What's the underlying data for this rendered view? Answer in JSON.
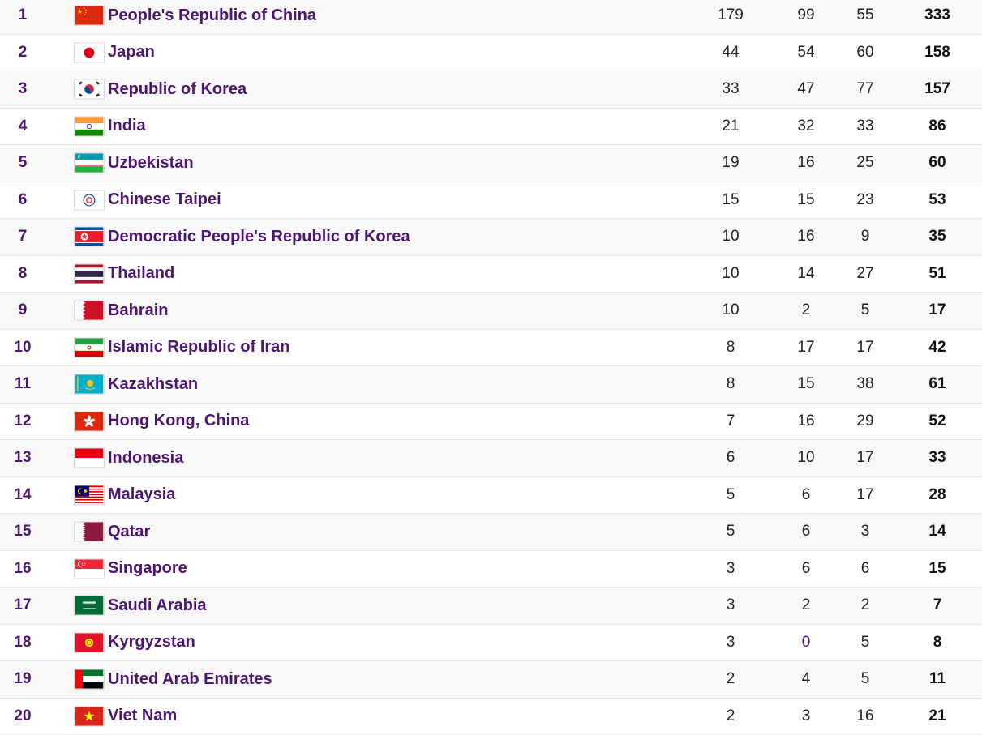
{
  "rows": [
    {
      "rank": "1",
      "country": "People's Republic of China",
      "flag": "china-flag",
      "gold": "179",
      "silver": "99",
      "bronze": "55",
      "total": "333"
    },
    {
      "rank": "2",
      "country": "Japan",
      "flag": "japan-flag",
      "gold": "44",
      "silver": "54",
      "bronze": "60",
      "total": "158"
    },
    {
      "rank": "3",
      "country": "Republic of Korea",
      "flag": "korea-flag",
      "gold": "33",
      "silver": "47",
      "bronze": "77",
      "total": "157"
    },
    {
      "rank": "4",
      "country": "India",
      "flag": "india-flag",
      "gold": "21",
      "silver": "32",
      "bronze": "33",
      "total": "86"
    },
    {
      "rank": "5",
      "country": "Uzbekistan",
      "flag": "uzbekistan-flag",
      "gold": "19",
      "silver": "16",
      "bronze": "25",
      "total": "60"
    },
    {
      "rank": "6",
      "country": "Chinese Taipei",
      "flag": "chinese-taipei-flag",
      "gold": "15",
      "silver": "15",
      "bronze": "23",
      "total": "53"
    },
    {
      "rank": "7",
      "country": "Democratic People's Republic of Korea",
      "flag": "dprk-flag",
      "gold": "10",
      "silver": "16",
      "bronze": "9",
      "total": "35"
    },
    {
      "rank": "8",
      "country": "Thailand",
      "flag": "thailand-flag",
      "gold": "10",
      "silver": "14",
      "bronze": "27",
      "total": "51"
    },
    {
      "rank": "9",
      "country": "Bahrain",
      "flag": "bahrain-flag",
      "gold": "10",
      "silver": "2",
      "bronze": "5",
      "total": "17"
    },
    {
      "rank": "10",
      "country": "Islamic Republic of Iran",
      "flag": "iran-flag",
      "gold": "8",
      "silver": "17",
      "bronze": "17",
      "total": "42"
    },
    {
      "rank": "11",
      "country": "Kazakhstan",
      "flag": "kazakhstan-flag",
      "gold": "8",
      "silver": "15",
      "bronze": "38",
      "total": "61"
    },
    {
      "rank": "12",
      "country": "Hong Kong, China",
      "flag": "hong-kong-flag",
      "gold": "7",
      "silver": "16",
      "bronze": "29",
      "total": "52"
    },
    {
      "rank": "13",
      "country": "Indonesia",
      "flag": "indonesia-flag",
      "gold": "6",
      "silver": "10",
      "bronze": "17",
      "total": "33"
    },
    {
      "rank": "14",
      "country": "Malaysia",
      "flag": "malaysia-flag",
      "gold": "5",
      "silver": "6",
      "bronze": "17",
      "total": "28"
    },
    {
      "rank": "15",
      "country": "Qatar",
      "flag": "qatar-flag",
      "gold": "5",
      "silver": "6",
      "bronze": "3",
      "total": "14"
    },
    {
      "rank": "16",
      "country": "Singapore",
      "flag": "singapore-flag",
      "gold": "3",
      "silver": "6",
      "bronze": "6",
      "total": "15"
    },
    {
      "rank": "17",
      "country": "Saudi Arabia",
      "flag": "saudi-arabia-flag",
      "gold": "3",
      "silver": "2",
      "bronze": "2",
      "total": "7"
    },
    {
      "rank": "18",
      "country": "Kyrgyzstan",
      "flag": "kyrgyzstan-flag",
      "gold": "3",
      "silver": "0",
      "bronze": "5",
      "total": "8"
    },
    {
      "rank": "19",
      "country": "United Arab Emirates",
      "flag": "uae-flag",
      "gold": "2",
      "silver": "4",
      "bronze": "5",
      "total": "11"
    },
    {
      "rank": "20",
      "country": "Viet Nam",
      "flag": "viet-nam-flag",
      "gold": "2",
      "silver": "3",
      "bronze": "16",
      "total": "21"
    }
  ],
  "colors": {
    "country_link": "#4b1670",
    "rank": "#4b1670",
    "row_alt": "#f8f8f8",
    "divider": "#e6e6e6"
  }
}
